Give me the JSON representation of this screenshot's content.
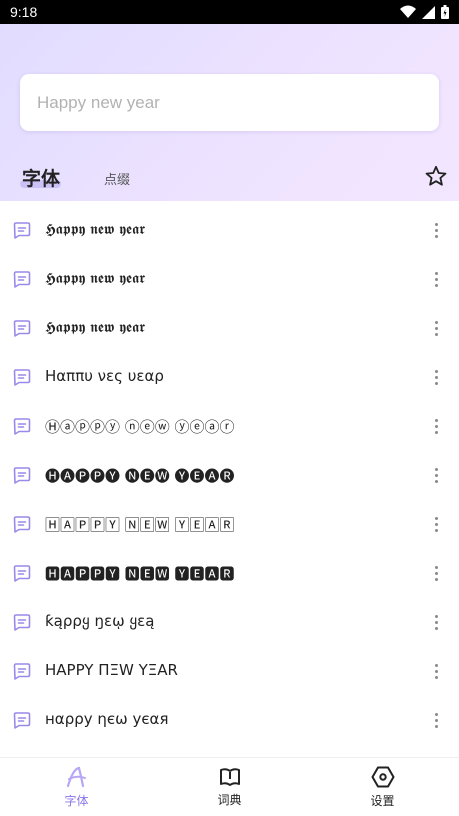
{
  "status": {
    "time": "9:18"
  },
  "search": {
    "placeholder": "Happy new year"
  },
  "tabs": {
    "main": "字体",
    "secondary": "点缀"
  },
  "fonts": [
    {
      "text": "𝕳𝖆𝖕𝖕𝖞 𝖓𝖊𝖜 𝖞𝖊𝖆𝖗"
    },
    {
      "text": "𝕳𝖆𝖕𝖕𝖞 𝖓𝖊𝖜 𝖞𝖊𝖆𝖗"
    },
    {
      "text": "𝕳𝖆𝖕𝖕𝖞 𝖓𝖊𝖜 𝖞𝖊𝖆𝖗"
    },
    {
      "text": "Ηαππυ νες υεαρ"
    },
    {
      "text": "Ⓗⓐⓟⓟⓨ ⓝⓔⓦ ⓨⓔⓐⓡ"
    },
    {
      "text": "🅗🅐🅟🅟🅨 🅝🅔🅦 🅨🅔🅐🅡"
    },
    {
      "text": "🄷🄰🄿🄿🅈 🄽🄴🅆 🅈🄴🄰🅁"
    },
    {
      "text": "🅷🅰🅿🅿🆈 🅽🅴🆆 🆈🅴🅰🆁"
    },
    {
      "text": "ƙąρρყ ŋɛῳ ყɛą"
    },
    {
      "text": "HAPPY ΠΞW YΞAR"
    },
    {
      "text": "нαρρу ηєω уєαя"
    }
  ],
  "nav": {
    "fonts": "字体",
    "dictionary": "词典",
    "settings": "设置"
  },
  "colors": {
    "accent": "#8b74e8",
    "header_start": "#e1dcff",
    "header_end": "#f3e6ff"
  }
}
